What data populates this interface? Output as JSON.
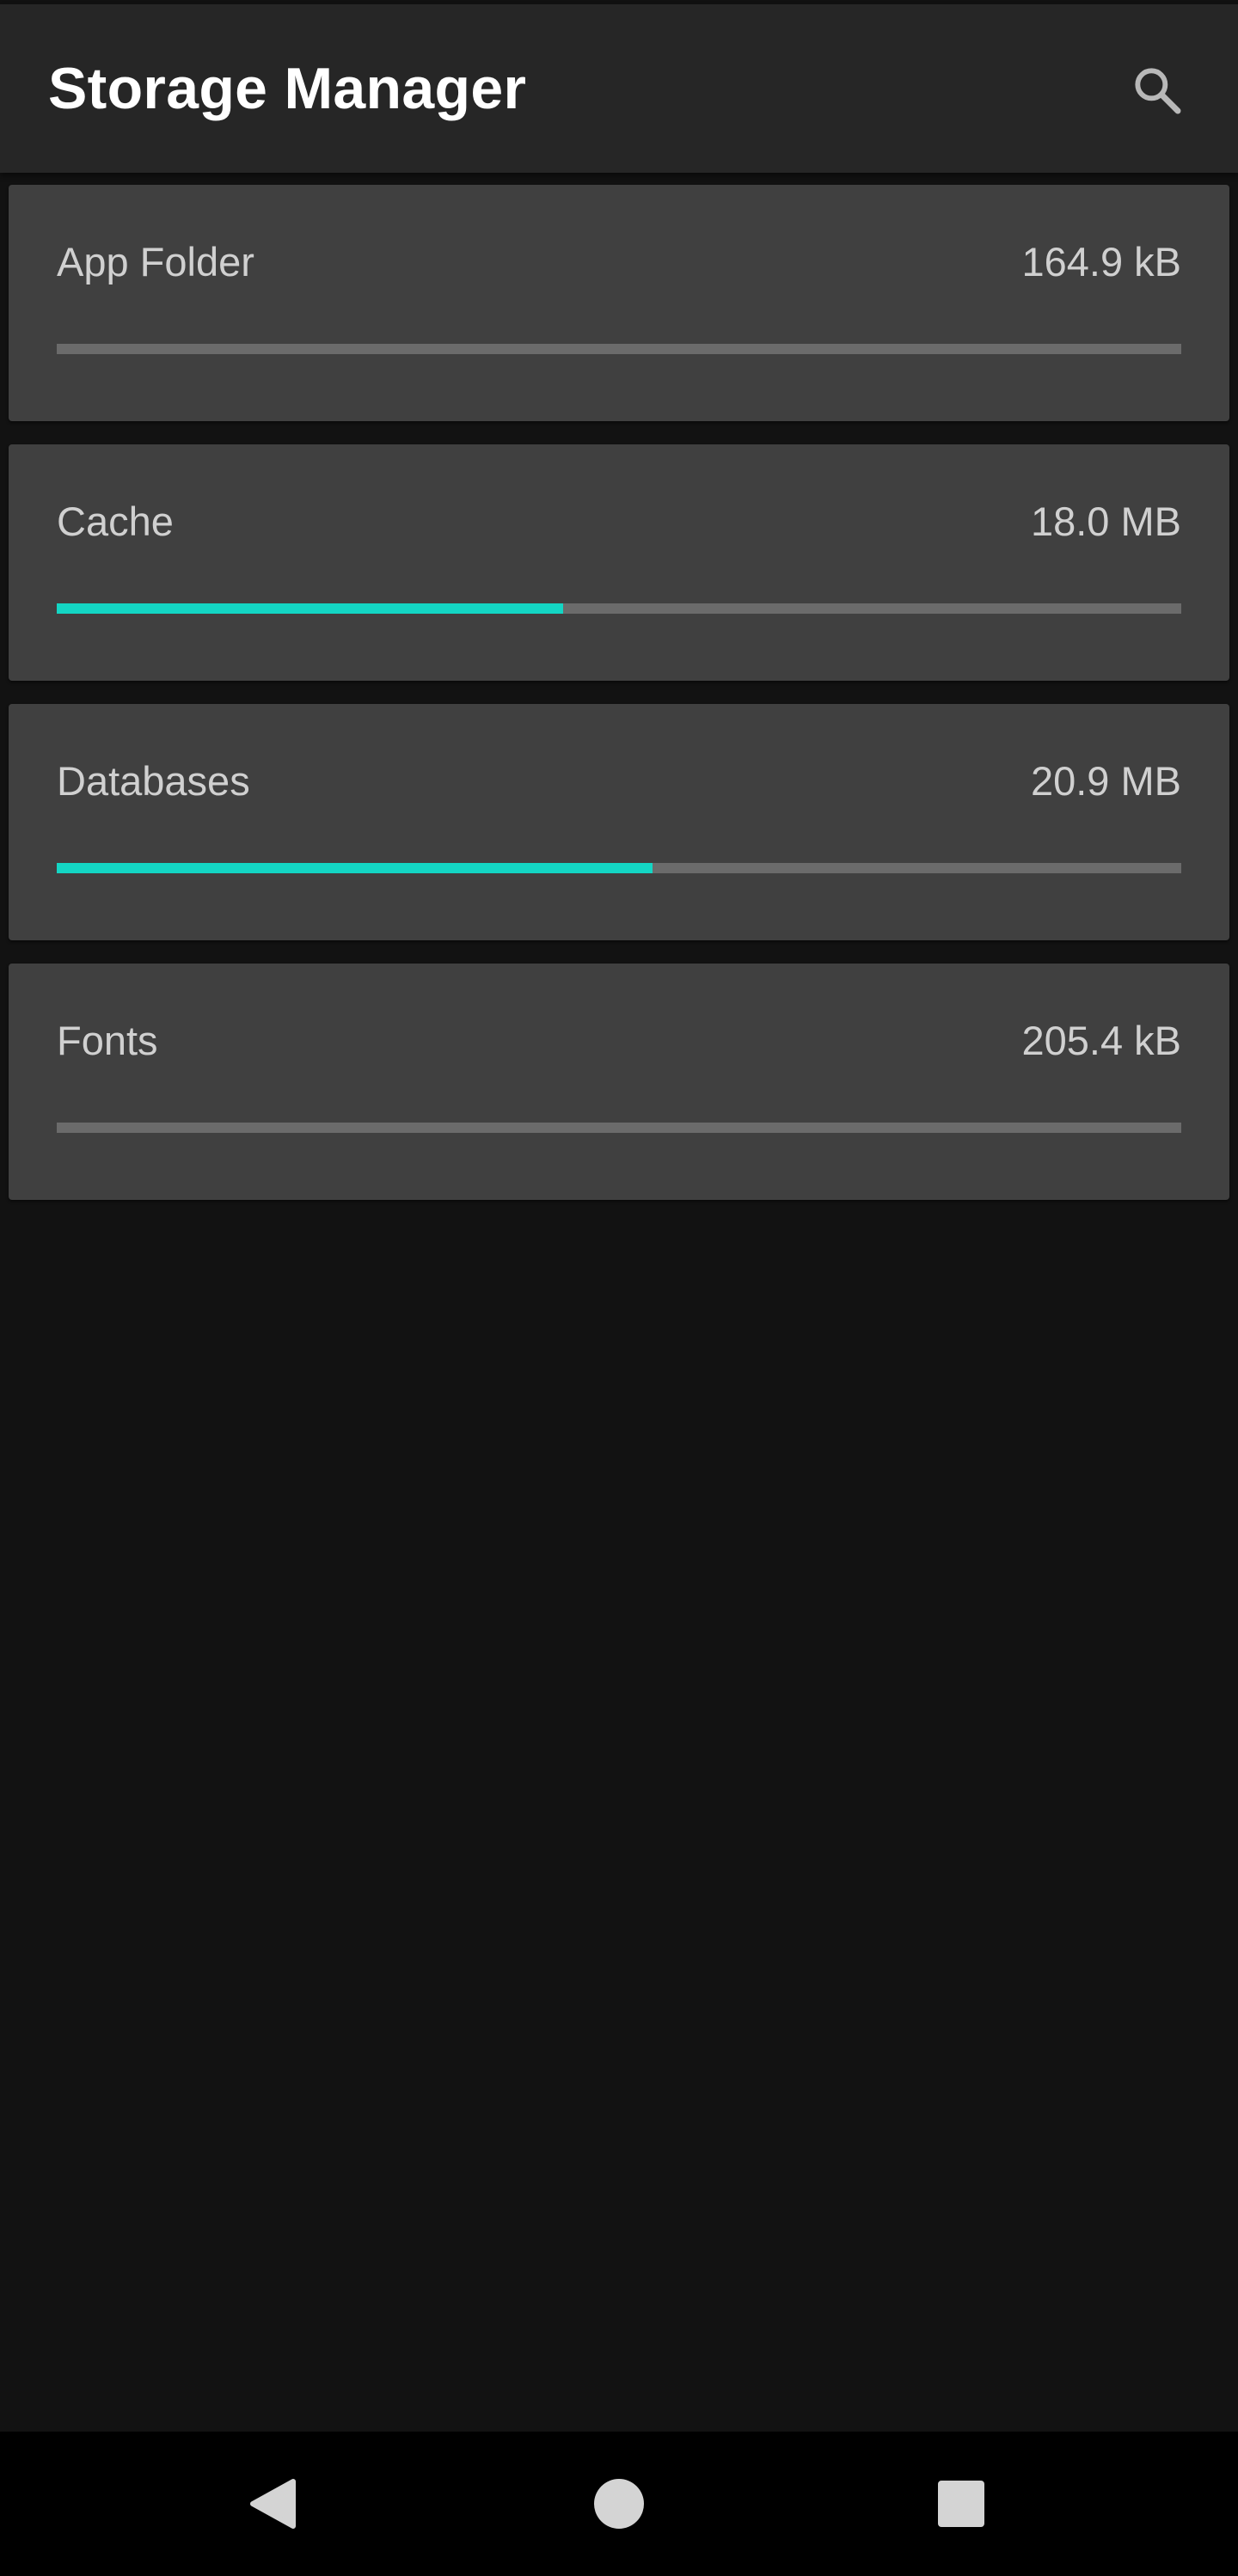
{
  "app_bar": {
    "title": "Storage Manager",
    "search_icon": "search-icon"
  },
  "storage_items": [
    {
      "label": "App Folder",
      "size": "164.9 kB",
      "usage_fraction": 0.0
    },
    {
      "label": "Cache",
      "size": "18.0 MB",
      "usage_fraction": 0.45
    },
    {
      "label": "Databases",
      "size": "20.9 MB",
      "usage_fraction": 0.53
    },
    {
      "label": "Fonts",
      "size": "205.4 kB",
      "usage_fraction": 0.0
    }
  ],
  "navigation": {
    "back_icon": "back-triangle-icon",
    "home_icon": "home-circle-icon",
    "recents_icon": "recents-square-icon"
  },
  "colors": {
    "accent": "#14d6c4",
    "app_bar": "#262626",
    "card": "#404040",
    "background": "#121212",
    "track": "#6b6b6b"
  }
}
